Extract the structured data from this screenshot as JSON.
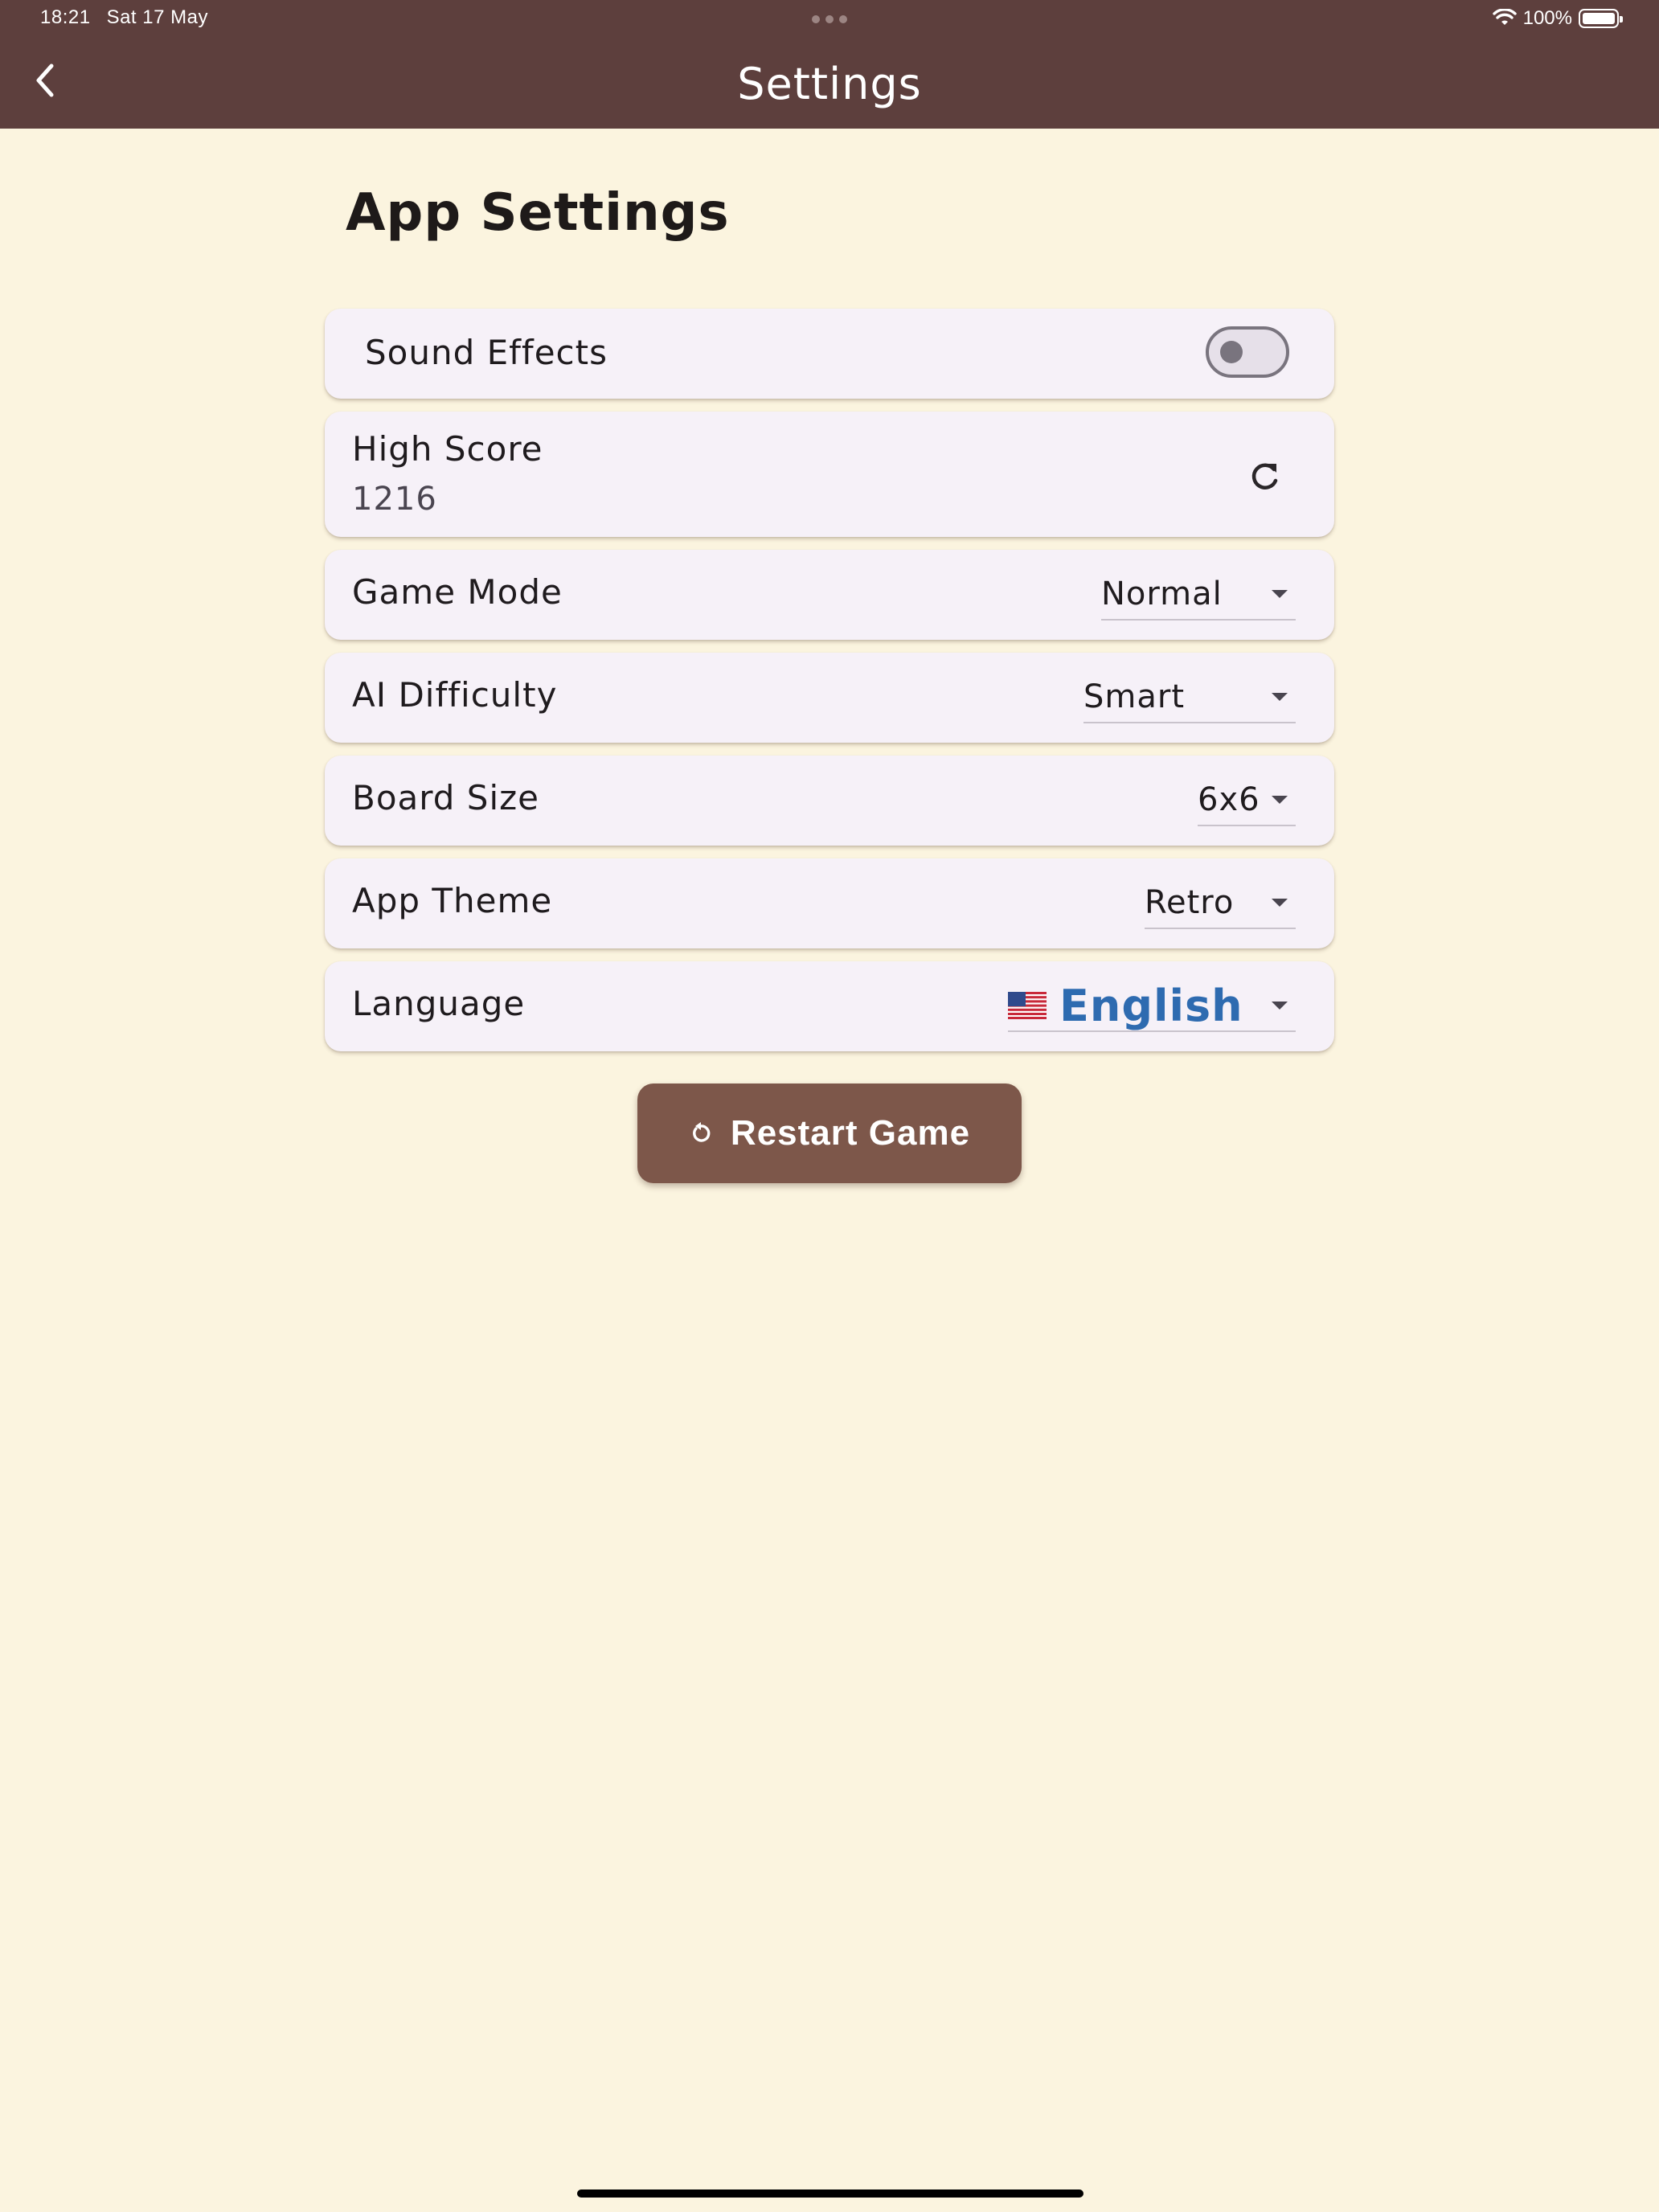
{
  "status_bar": {
    "time": "18:21",
    "date": "Sat 17 May",
    "battery": "100%",
    "icons": [
      "wifi-icon",
      "battery-icon"
    ]
  },
  "app_bar": {
    "title": "Settings",
    "back_icon": "chevron-left-icon",
    "color": "#5D3F3D"
  },
  "section_title": "App Settings",
  "settings": {
    "sound_effects": {
      "label": "Sound Effects",
      "enabled": false
    },
    "high_score": {
      "label": "High Score",
      "value": "1216",
      "action_icon": "refresh-icon"
    },
    "game_mode": {
      "label": "Game Mode",
      "value": "Normal"
    },
    "ai_difficulty": {
      "label": "AI Difficulty",
      "value": "Smart"
    },
    "board_size": {
      "label": "Board Size",
      "value": "6x6"
    },
    "app_theme": {
      "label": "App Theme",
      "value": "Retro"
    },
    "language": {
      "label": "Language",
      "value": "English",
      "flag_icon": "us-flag-icon"
    }
  },
  "restart_button": {
    "label": "Restart Game",
    "icon": "restart-icon",
    "color": "#7D574A"
  },
  "colors": {
    "background": "#FBF4DF",
    "card": "#F6F1F8",
    "language_text": "#2E6BB0"
  }
}
